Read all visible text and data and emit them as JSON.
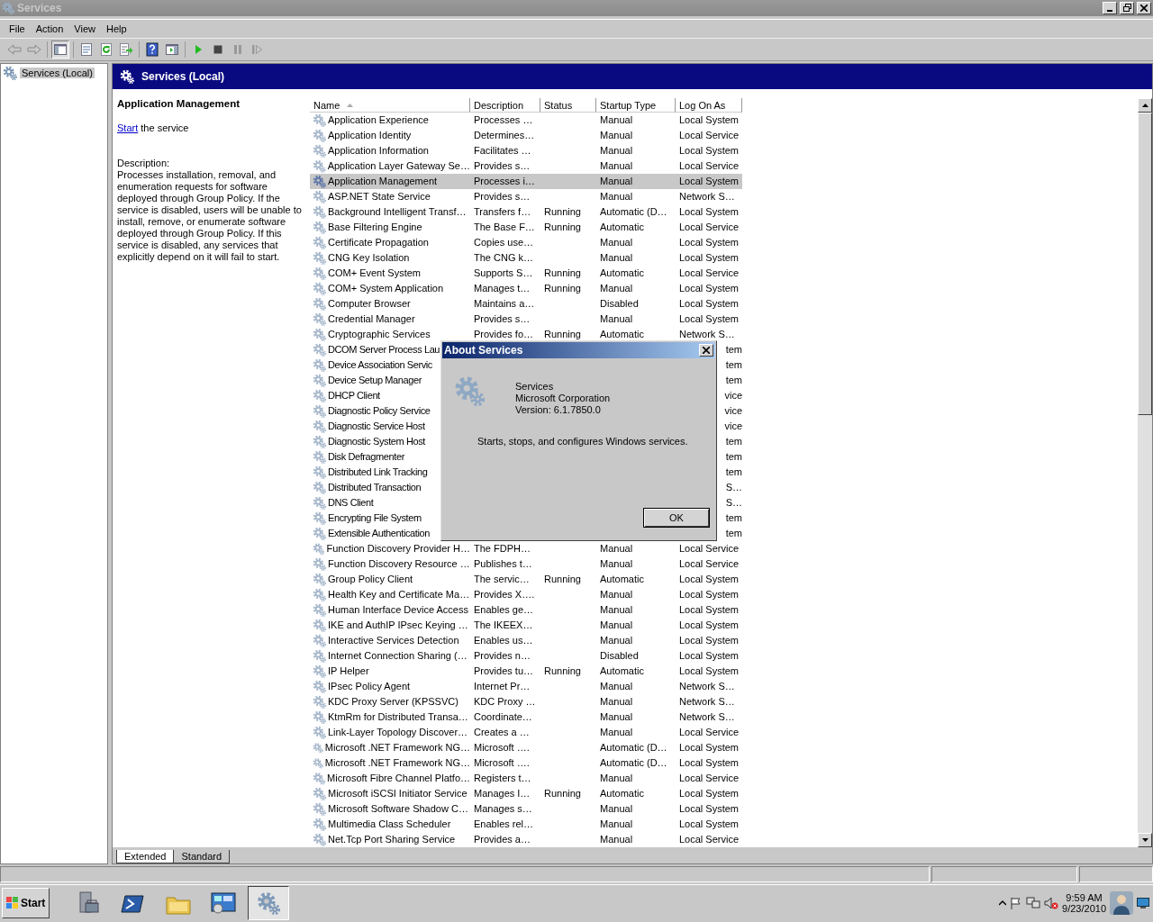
{
  "window": {
    "title": "Services"
  },
  "menu": [
    "File",
    "Action",
    "View",
    "Help"
  ],
  "toolbar": [
    [
      {
        "kind": "back",
        "pressed": false
      },
      {
        "kind": "forward",
        "pressed": false
      }
    ],
    [
      {
        "kind": "console_tree",
        "pressed": true
      }
    ],
    [
      {
        "kind": "properties",
        "pressed": false
      },
      {
        "kind": "refresh",
        "pressed": false
      },
      {
        "kind": "export",
        "pressed": false
      }
    ],
    [
      {
        "kind": "help",
        "pressed": false
      },
      {
        "kind": "action_pane",
        "pressed": false
      }
    ],
    [
      {
        "kind": "play",
        "pressed": false
      },
      {
        "kind": "stop",
        "pressed": false
      },
      {
        "kind": "pause",
        "pressed": false
      },
      {
        "kind": "resume",
        "pressed": false
      }
    ]
  ],
  "tree": [
    {
      "label": "Services (Local)",
      "selected": true
    }
  ],
  "header": {
    "title": "Services (Local)"
  },
  "detail": {
    "title": "Application Management",
    "action_link": "Start",
    "action_rest": "the service",
    "description_label": "Description:",
    "description": "Processes installation, removal, and enumeration requests for software deployed through Group Policy. If the service is disabled, users will be unable to install, remove, or enumerate software deployed through Group Policy. If this service is disabled, any services that explicitly depend on it will fail to start."
  },
  "table": {
    "columns": [
      {
        "label": "Name",
        "sorted": true
      },
      {
        "label": "Description",
        "sorted": false
      },
      {
        "label": "Status",
        "sorted": false
      },
      {
        "label": "Startup Type",
        "sorted": false
      },
      {
        "label": "Log On As",
        "sorted": false
      }
    ],
    "rows": [
      {
        "kind": "full",
        "name": "Application Experience",
        "description": "Processes …",
        "status": "",
        "startup": "Manual",
        "logon": "Local System",
        "selected": false
      },
      {
        "kind": "full",
        "name": "Application Identity",
        "description": "Determines…",
        "status": "",
        "startup": "Manual",
        "logon": "Local Service",
        "selected": false
      },
      {
        "kind": "full",
        "name": "Application Information",
        "description": "Facilitates …",
        "status": "",
        "startup": "Manual",
        "logon": "Local System",
        "selected": false
      },
      {
        "kind": "full",
        "name": "Application Layer Gateway Se…",
        "description": "Provides s…",
        "status": "",
        "startup": "Manual",
        "logon": "Local Service",
        "selected": false
      },
      {
        "kind": "full",
        "name": "Application Management",
        "description": "Processes i…",
        "status": "",
        "startup": "Manual",
        "logon": "Local System",
        "selected": true
      },
      {
        "kind": "full",
        "name": "ASP.NET State Service",
        "description": "Provides s…",
        "status": "",
        "startup": "Manual",
        "logon": "Network S…",
        "selected": false
      },
      {
        "kind": "full",
        "name": "Background Intelligent Transf…",
        "description": "Transfers f…",
        "status": "Running",
        "startup": "Automatic (D…",
        "logon": "Local System",
        "selected": false
      },
      {
        "kind": "full",
        "name": "Base Filtering Engine",
        "description": "The Base F…",
        "status": "Running",
        "startup": "Automatic",
        "logon": "Local Service",
        "selected": false
      },
      {
        "kind": "full",
        "name": "Certificate Propagation",
        "description": "Copies use…",
        "status": "",
        "startup": "Manual",
        "logon": "Local System",
        "selected": false
      },
      {
        "kind": "full",
        "name": "CNG Key Isolation",
        "description": "The CNG k…",
        "status": "",
        "startup": "Manual",
        "logon": "Local System",
        "selected": false
      },
      {
        "kind": "full",
        "name": "COM+ Event System",
        "description": "Supports S…",
        "status": "Running",
        "startup": "Automatic",
        "logon": "Local Service",
        "selected": false
      },
      {
        "kind": "full",
        "name": "COM+ System Application",
        "description": "Manages t…",
        "status": "Running",
        "startup": "Manual",
        "logon": "Local System",
        "selected": false
      },
      {
        "kind": "full",
        "name": "Computer Browser",
        "description": "Maintains a…",
        "status": "",
        "startup": "Disabled",
        "logon": "Local System",
        "selected": false
      },
      {
        "kind": "full",
        "name": "Credential Manager",
        "description": "Provides s…",
        "status": "",
        "startup": "Manual",
        "logon": "Local System",
        "selected": false
      },
      {
        "kind": "full",
        "name": "Cryptographic Services",
        "description": "Provides fo…",
        "status": "Running",
        "startup": "Automatic",
        "logon": "Network S…",
        "selected": false
      },
      {
        "kind": "covered",
        "name": "DCOM Server Process Lau",
        "logon": "tem",
        "selected": false
      },
      {
        "kind": "covered",
        "name": "Device Association Servic",
        "logon": "tem",
        "selected": false
      },
      {
        "kind": "covered",
        "name": "Device Setup Manager",
        "logon": "tem",
        "selected": false
      },
      {
        "kind": "covered",
        "name": "DHCP Client",
        "logon": "vice",
        "selected": false
      },
      {
        "kind": "covered",
        "name": "Diagnostic Policy Service",
        "logon": "vice",
        "selected": false
      },
      {
        "kind": "covered",
        "name": "Diagnostic Service Host",
        "logon": "vice",
        "selected": false
      },
      {
        "kind": "covered",
        "name": "Diagnostic System Host",
        "logon": "tem",
        "selected": false
      },
      {
        "kind": "covered",
        "name": "Disk Defragmenter",
        "logon": "tem",
        "selected": false
      },
      {
        "kind": "covered",
        "name": "Distributed Link Tracking",
        "logon": "tem",
        "selected": false
      },
      {
        "kind": "covered",
        "name": "Distributed Transaction",
        "logon": "S…",
        "selected": false
      },
      {
        "kind": "covered",
        "name": "DNS Client",
        "logon": "S…",
        "selected": false
      },
      {
        "kind": "covered",
        "name": "Encrypting File System",
        "logon": "tem",
        "selected": false
      },
      {
        "kind": "covered",
        "name": "Extensible Authentication",
        "logon": "tem",
        "selected": false
      },
      {
        "kind": "full",
        "name": "Function Discovery Provider H…",
        "description": "The FDPH…",
        "status": "",
        "startup": "Manual",
        "logon": "Local Service",
        "selected": false
      },
      {
        "kind": "full",
        "name": "Function Discovery Resource …",
        "description": "Publishes t…",
        "status": "",
        "startup": "Manual",
        "logon": "Local Service",
        "selected": false
      },
      {
        "kind": "full",
        "name": "Group Policy Client",
        "description": "The servic…",
        "status": "Running",
        "startup": "Automatic",
        "logon": "Local System",
        "selected": false
      },
      {
        "kind": "full",
        "name": "Health Key and Certificate Ma…",
        "description": "Provides X….",
        "status": "",
        "startup": "Manual",
        "logon": "Local System",
        "selected": false
      },
      {
        "kind": "full",
        "name": "Human Interface Device Access",
        "description": "Enables ge…",
        "status": "",
        "startup": "Manual",
        "logon": "Local System",
        "selected": false
      },
      {
        "kind": "full",
        "name": "IKE and AuthIP IPsec Keying …",
        "description": "The IKEEX…",
        "status": "",
        "startup": "Manual",
        "logon": "Local System",
        "selected": false
      },
      {
        "kind": "full",
        "name": "Interactive Services Detection",
        "description": "Enables us…",
        "status": "",
        "startup": "Manual",
        "logon": "Local System",
        "selected": false
      },
      {
        "kind": "full",
        "name": "Internet Connection Sharing (…",
        "description": "Provides n…",
        "status": "",
        "startup": "Disabled",
        "logon": "Local System",
        "selected": false
      },
      {
        "kind": "full",
        "name": "IP Helper",
        "description": "Provides tu…",
        "status": "Running",
        "startup": "Automatic",
        "logon": "Local System",
        "selected": false
      },
      {
        "kind": "full",
        "name": "IPsec Policy Agent",
        "description": "Internet Pr…",
        "status": "",
        "startup": "Manual",
        "logon": "Network S…",
        "selected": false
      },
      {
        "kind": "full",
        "name": "KDC Proxy Server (KPSSVC)",
        "description": "KDC Proxy …",
        "status": "",
        "startup": "Manual",
        "logon": "Network S…",
        "selected": false
      },
      {
        "kind": "full",
        "name": "KtmRm for Distributed Transa…",
        "description": "Coordinate…",
        "status": "",
        "startup": "Manual",
        "logon": "Network S…",
        "selected": false
      },
      {
        "kind": "full",
        "name": "Link-Layer Topology Discover…",
        "description": "Creates a …",
        "status": "",
        "startup": "Manual",
        "logon": "Local Service",
        "selected": false
      },
      {
        "kind": "full",
        "name": "Microsoft .NET Framework NG…",
        "description": "Microsoft ….",
        "status": "",
        "startup": "Automatic (D…",
        "logon": "Local System",
        "selected": false
      },
      {
        "kind": "full",
        "name": "Microsoft .NET Framework NG…",
        "description": "Microsoft ….",
        "status": "",
        "startup": "Automatic (D…",
        "logon": "Local System",
        "selected": false
      },
      {
        "kind": "full",
        "name": "Microsoft Fibre Channel Platfo…",
        "description": "Registers t…",
        "status": "",
        "startup": "Manual",
        "logon": "Local Service",
        "selected": false
      },
      {
        "kind": "full",
        "name": "Microsoft iSCSI Initiator Service",
        "description": "Manages I…",
        "status": "Running",
        "startup": "Automatic",
        "logon": "Local System",
        "selected": false
      },
      {
        "kind": "full",
        "name": "Microsoft Software Shadow C…",
        "description": "Manages s…",
        "status": "",
        "startup": "Manual",
        "logon": "Local System",
        "selected": false
      },
      {
        "kind": "full",
        "name": "Multimedia Class Scheduler",
        "description": "Enables rel…",
        "status": "",
        "startup": "Manual",
        "logon": "Local System",
        "selected": false
      },
      {
        "kind": "full",
        "name": "Net.Tcp Port Sharing Service",
        "description": "Provides a…",
        "status": "",
        "startup": "Manual",
        "logon": "Local Service",
        "selected": false
      }
    ]
  },
  "tabs": [
    {
      "label": "Extended",
      "selected": true
    },
    {
      "label": "Standard",
      "selected": false
    }
  ],
  "dialog": {
    "title": "About Services",
    "product": "Services",
    "company": "Microsoft Corporation",
    "version": "Version: 6.1.7850.0",
    "summary": "Starts, stops, and configures Windows services.",
    "button": "OK"
  },
  "taskbar": {
    "start": "Start",
    "apps": [
      {
        "kind": "server",
        "selected": false
      },
      {
        "kind": "powershell",
        "selected": false
      },
      {
        "kind": "folder",
        "selected": false
      },
      {
        "kind": "control",
        "selected": false
      },
      {
        "kind": "services",
        "selected": true
      }
    ],
    "time": "9:59 AM",
    "date": "9/23/2010"
  }
}
